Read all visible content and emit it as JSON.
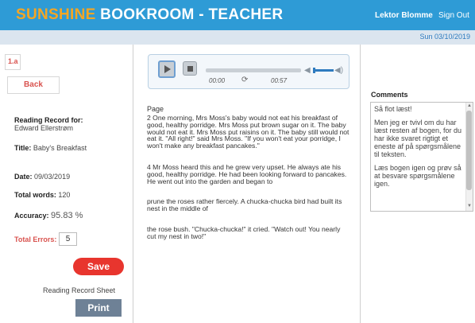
{
  "header": {
    "brand_part1": "SUNSHINE",
    "brand_part2": " BOOKROOM - TEACHER",
    "user": "Lektor Blomme",
    "sign_out": "Sign Out",
    "date": "Sun 03/10/2019"
  },
  "left": {
    "tag": "1.a",
    "back": "Back",
    "record_for_label": "Reading Record for:",
    "student": "Edward Ellerstrøm",
    "title_label": "Title:",
    "title_value": "Baby's Breakfast",
    "date_label": "Date:",
    "date_value": "09/03/2019",
    "words_label": "Total words:",
    "words_value": "120",
    "accuracy_label": "Accuracy:",
    "accuracy_value": "95.83 %",
    "errors_label": "Total Errors:",
    "errors_value": "5",
    "save": "Save",
    "sheet_label": "Reading Record Sheet",
    "print": "Print"
  },
  "player": {
    "current_time": "00:00",
    "duration": "00:57",
    "loop_icon": "loop-icon",
    "play_icon": "play-icon",
    "stop_icon": "stop-icon",
    "volume_icon": "volume-icon"
  },
  "text": {
    "page_label": "Page",
    "paragraphs": [
      "2 One morning, Mrs Moss's baby would not eat his breakfast of good, healthy porridge. Mrs Moss put brown sugar on it. The baby would not eat it. Mrs Moss put raisins on it. The baby still would not eat it. \"All right!\" said Mrs Moss. \"If you won't eat your porridge, I won't make any breakfast pancakes.\"",
      "4 Mr Moss heard this and he grew very upset. He always ate his good, healthy porridge. He had been looking forward to pancakes. He went out into the garden and began to",
      "prune the roses rather fiercely. A chucka-chucka bird had built its nest in the middle of",
      "the rose bush. \"Chucka-chucka!\" it cried. \"Watch out! You nearly cut my nest in two!\""
    ]
  },
  "comments": {
    "label": "Comments",
    "paragraphs": [
      "Så flot læst!",
      "Men jeg er tvivl om du har læst resten af bogen, for du har ikke svaret rigtigt et eneste af på spørgsmålene til teksten.",
      "Læs bogen igen og prøv så at besvare spørgsmålene igen."
    ]
  },
  "colors": {
    "header_bg": "#2e9bd6",
    "brand_accent": "#f5a623",
    "save_red": "#e8352e",
    "print_slate": "#6e8196"
  }
}
